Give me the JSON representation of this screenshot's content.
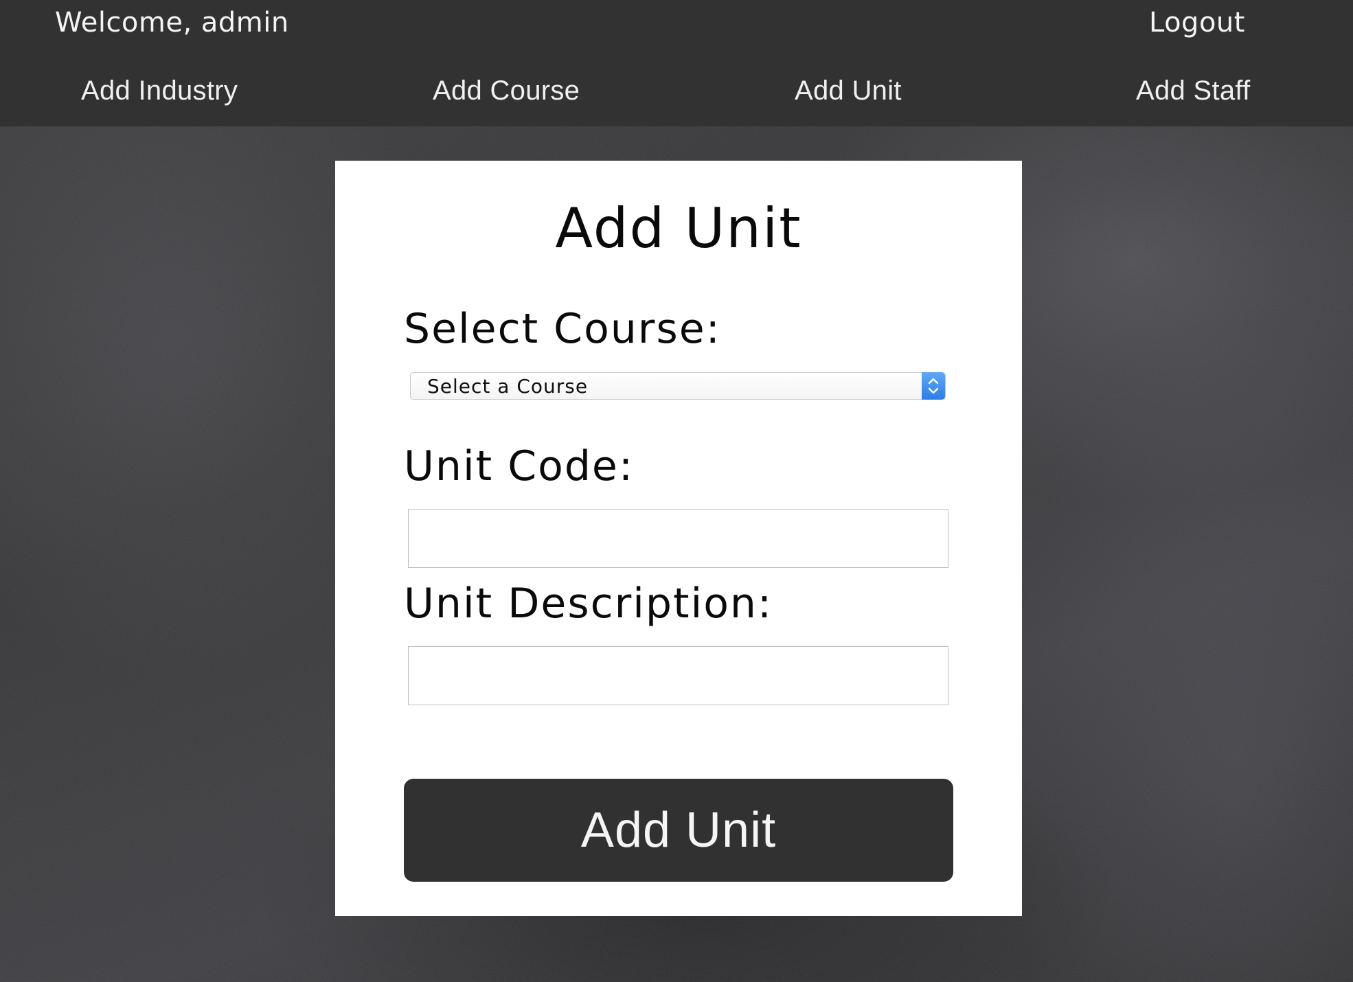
{
  "header": {
    "welcome_text": "Welcome, admin",
    "logout_label": "Logout",
    "nav": {
      "add_industry": "Add Industry",
      "add_course": "Add Course",
      "add_unit": "Add Unit",
      "add_staff": "Add Staff"
    }
  },
  "form": {
    "title": "Add Unit",
    "course_label": "Select Course:",
    "course_select_value": "Select a Course",
    "unit_code_label": "Unit Code:",
    "unit_code_value": "",
    "unit_description_label": "Unit Description:",
    "unit_description_value": "",
    "submit_label": "Add Unit"
  },
  "colors": {
    "header_bg": "#323232",
    "button_bg": "#313131",
    "card_bg": "#ffffff",
    "select_accent": "#2e7de9"
  },
  "icons": {
    "select_arrows": "chevron-up-down-icon"
  }
}
